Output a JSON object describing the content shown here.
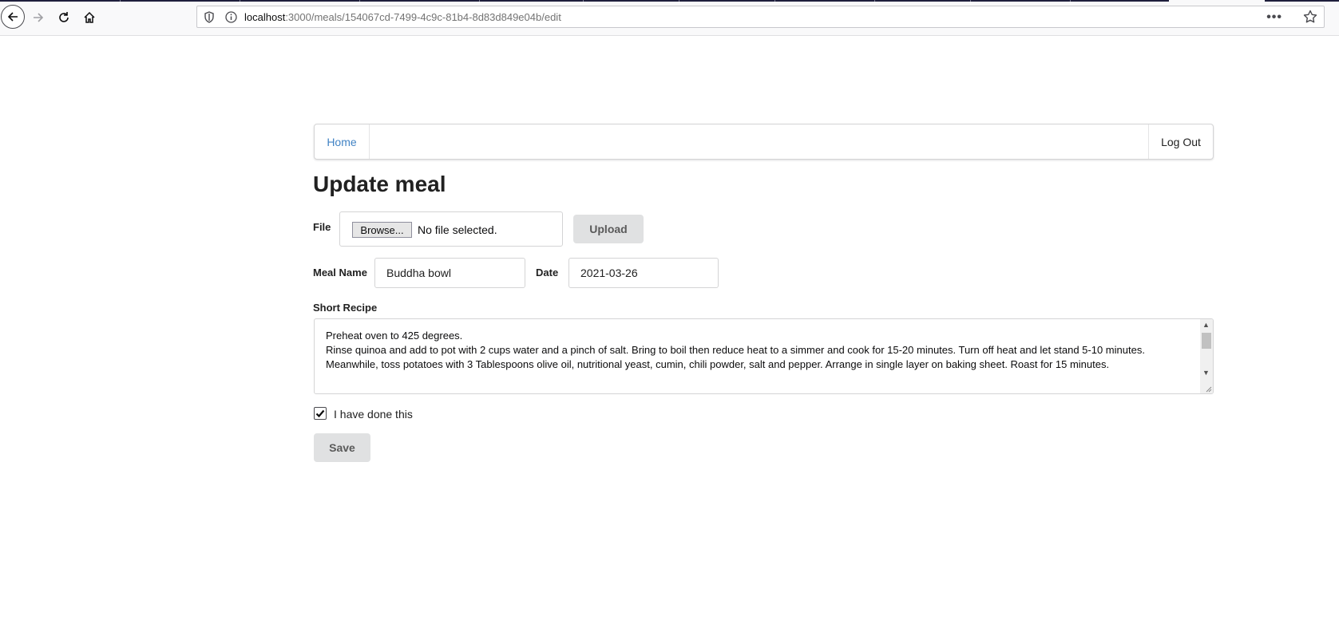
{
  "browser": {
    "url_host": "localhost",
    "url_rest": ":3000/meals/154067cd-7499-4c9c-81b4-8d83d849e04b/edit",
    "icons": [
      "back-icon",
      "forward-icon",
      "reload-icon",
      "home-icon",
      "shield-icon",
      "info-icon",
      "more-icon",
      "star-icon"
    ]
  },
  "nav": {
    "home": "Home",
    "logout": "Log Out"
  },
  "page": {
    "title": "Update meal"
  },
  "file": {
    "label": "File",
    "browse": "Browse...",
    "status": "No file selected.",
    "upload": "Upload"
  },
  "meal": {
    "name_label": "Meal Name",
    "name_value": "Buddha bowl",
    "date_label": "Date",
    "date_value": "2021-03-26"
  },
  "recipe": {
    "label": "Short Recipe",
    "text": "Preheat oven to 425 degrees.\nRinse quinoa and add to pot with 2 cups water and a pinch of salt. Bring to boil then reduce heat to a simmer and cook for 15-20 minutes. Turn off heat and let stand 5-10 minutes.\nMeanwhile, toss potatoes with 3 Tablespoons olive oil, nutritional yeast, cumin, chili powder, salt and pepper. Arrange in single layer on baking sheet. Roast for 15 minutes."
  },
  "done": {
    "label": "I have done this",
    "checked": true
  },
  "save": "Save",
  "colors": {
    "link": "#4183c4",
    "button_bg": "#e0e1e2",
    "text": "#212121"
  }
}
